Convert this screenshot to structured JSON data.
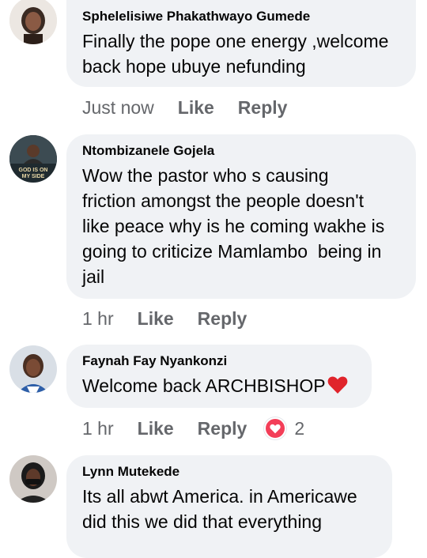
{
  "comments": [
    {
      "author": "Sphelelisiwe Phakathwayo Gumede",
      "lines": [
        "Finally the pope one energy ,welcome",
        "back hope ubuye nefunding"
      ],
      "time": "Just now",
      "like": "Like",
      "reply": "Reply"
    },
    {
      "author": "Ntombizanele Gojela",
      "avatar_text": "GOD IS ON MY SIDE",
      "lines": [
        "Wow the pastor who s causing",
        "friction amongst the people doesn't",
        "like peace why is he coming wakhe is",
        "going to criticize Mamlambo  being in",
        "jail"
      ],
      "time": "1 hr",
      "like": "Like",
      "reply": "Reply"
    },
    {
      "author": "Faynah Fay Nyankonzi",
      "lines": [
        "Welcome back ARCHBISHOP"
      ],
      "time": "1 hr",
      "like": "Like",
      "reply": "Reply",
      "reaction_count": "2"
    },
    {
      "author": "Lynn Mutekede",
      "lines": [
        "Its all abwt America. in Americawe",
        "did this we did that everything"
      ]
    }
  ],
  "colors": {
    "bubble": "#f0f2f5",
    "meta": "#65676b",
    "love": "#f33e58",
    "heart_emoji": "#e0242b"
  }
}
